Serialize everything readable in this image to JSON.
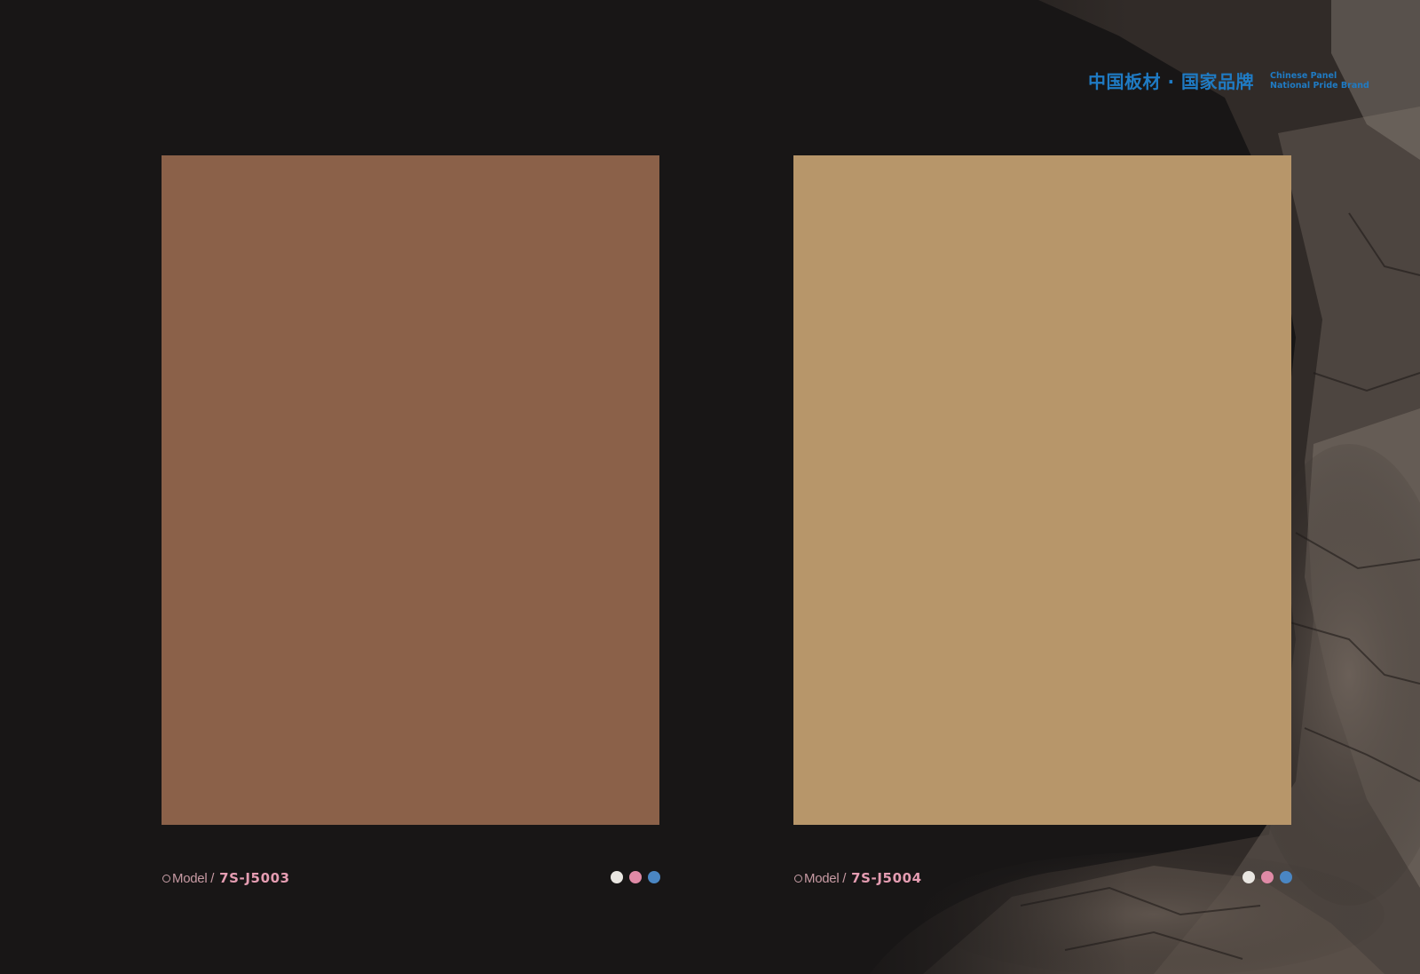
{
  "brand": {
    "cn": "中国板材 · 国家品牌",
    "en_line1": "Chinese Panel",
    "en_line2": "National Pride Brand",
    "color": "#1f7bc4"
  },
  "swatches": [
    {
      "color": "#8b6149",
      "model_label": "Model /",
      "model_code": "7S-J5003",
      "dots": [
        "#e9e6e1",
        "#e08aa6",
        "#4a86c3"
      ]
    },
    {
      "color": "#b7966a",
      "model_label": "Model /",
      "model_code": "7S-J5004",
      "dots": [
        "#e9e6e1",
        "#e08aa6",
        "#4a86c3"
      ]
    }
  ],
  "colors": {
    "background": "#181616",
    "model_label": "#c79aa3",
    "model_code": "#e59db2"
  }
}
